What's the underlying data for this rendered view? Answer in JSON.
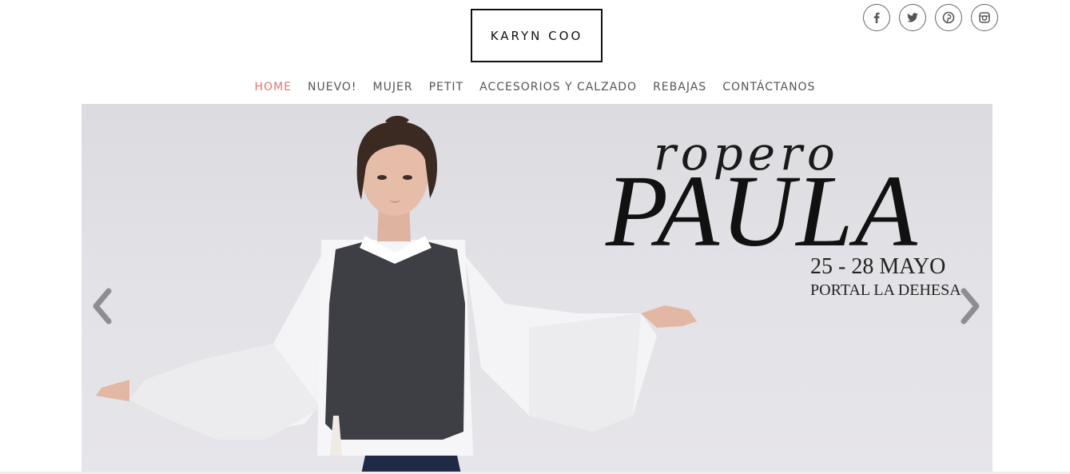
{
  "brand": {
    "logo_text": "KARYN COO"
  },
  "social": [
    {
      "name": "facebook",
      "glyph": "f"
    },
    {
      "name": "twitter",
      "glyph": "t"
    },
    {
      "name": "pinterest",
      "glyph": "p"
    },
    {
      "name": "instagram",
      "glyph": "i"
    }
  ],
  "nav": {
    "items": [
      {
        "label": "HOME",
        "active": true
      },
      {
        "label": "NUEVO!",
        "active": false
      },
      {
        "label": "MUJER",
        "active": false
      },
      {
        "label": "PETIT",
        "active": false
      },
      {
        "label": "ACCESORIOS Y CALZADO",
        "active": false
      },
      {
        "label": "REBAJAS",
        "active": false
      },
      {
        "label": "CONTÁCTANOS",
        "active": false
      }
    ]
  },
  "hero": {
    "script_text": "ropero",
    "title": "PAULA",
    "dates": "25 - 28 MAYO",
    "location": "PORTAL LA DEHESA"
  },
  "colors": {
    "active_nav": "#e8746a",
    "nav_text": "#555555",
    "hero_bg": "#e1e0e5"
  }
}
